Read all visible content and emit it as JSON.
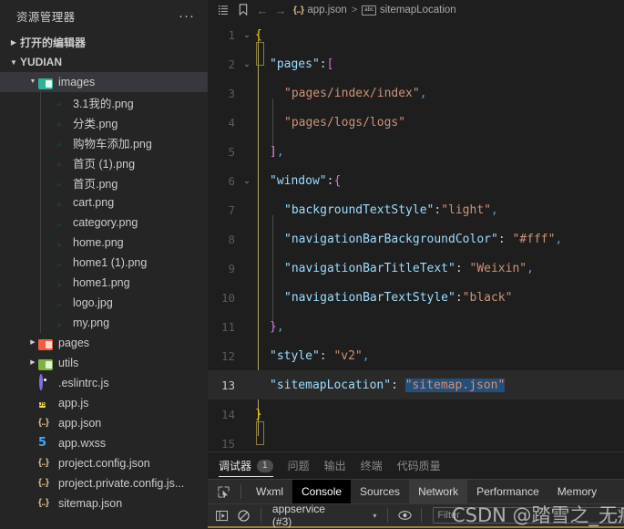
{
  "sidebar": {
    "title": "资源管理器",
    "more_label": "···",
    "sections": [
      {
        "label": "打开的编辑器",
        "expanded": false,
        "twisty": "▶"
      },
      {
        "label": "YUDIAN",
        "expanded": true,
        "twisty": "▼"
      }
    ],
    "tree": [
      {
        "label": "images",
        "icon": "folder-teal-icon",
        "depth": 1,
        "twisty": "▼",
        "selected": true
      },
      {
        "label": "3.1我的.png",
        "icon": "image-file-icon",
        "depth": 2,
        "twisty": "",
        "selected": false
      },
      {
        "label": "分类.png",
        "icon": "image-file-icon",
        "depth": 2,
        "twisty": "",
        "selected": false
      },
      {
        "label": "购物车添加.png",
        "icon": "image-file-icon",
        "depth": 2,
        "twisty": "",
        "selected": false
      },
      {
        "label": "首页 (1).png",
        "icon": "image-file-icon",
        "depth": 2,
        "twisty": "",
        "selected": false
      },
      {
        "label": "首页.png",
        "icon": "image-file-icon",
        "depth": 2,
        "twisty": "",
        "selected": false
      },
      {
        "label": "cart.png",
        "icon": "image-file-icon",
        "depth": 2,
        "twisty": "",
        "selected": false
      },
      {
        "label": "category.png",
        "icon": "image-file-icon",
        "depth": 2,
        "twisty": "",
        "selected": false
      },
      {
        "label": "home.png",
        "icon": "image-file-icon",
        "depth": 2,
        "twisty": "",
        "selected": false
      },
      {
        "label": "home1 (1).png",
        "icon": "image-file-icon",
        "depth": 2,
        "twisty": "",
        "selected": false
      },
      {
        "label": "home1.png",
        "icon": "image-file-icon",
        "depth": 2,
        "twisty": "",
        "selected": false
      },
      {
        "label": "logo.jpg",
        "icon": "image-file-icon",
        "depth": 2,
        "twisty": "",
        "selected": false
      },
      {
        "label": "my.png",
        "icon": "image-file-icon",
        "depth": 2,
        "twisty": "",
        "selected": false
      },
      {
        "label": "pages",
        "icon": "folder-orange-icon",
        "depth": 1,
        "twisty": "▶",
        "selected": false
      },
      {
        "label": "utils",
        "icon": "folder-green-icon",
        "depth": 1,
        "twisty": "▶",
        "selected": false
      },
      {
        "label": ".eslintrc.js",
        "icon": "eslint-icon",
        "depth": 1,
        "twisty": "",
        "selected": false
      },
      {
        "label": "app.js",
        "icon": "js-file-icon",
        "depth": 1,
        "twisty": "",
        "selected": false
      },
      {
        "label": "app.json",
        "icon": "json-file-icon",
        "depth": 1,
        "twisty": "",
        "selected": false
      },
      {
        "label": "app.wxss",
        "icon": "css-file-icon",
        "depth": 1,
        "twisty": "",
        "selected": false
      },
      {
        "label": "project.config.json",
        "icon": "json-file-icon",
        "depth": 1,
        "twisty": "",
        "selected": false
      },
      {
        "label": "project.private.config.js...",
        "icon": "json-file-icon",
        "depth": 1,
        "twisty": "",
        "selected": false
      },
      {
        "label": "sitemap.json",
        "icon": "json-file-icon",
        "depth": 1,
        "twisty": "",
        "selected": false
      }
    ]
  },
  "breadcrumb": {
    "outline_icon": "outline-list-icon",
    "bookmark_icon": "bookmark-icon",
    "back_arrow": "←",
    "forward_arrow": "→",
    "file_icon": "{..}",
    "file_label": "app.json",
    "separator": ">",
    "symbol_icon": "abc",
    "symbol_label": "sitemapLocation"
  },
  "editor": {
    "file": "app.json",
    "current_line": 13,
    "selection_text": "\"sitemap.json\"",
    "lines": [
      {
        "n": 1,
        "fold": "⌄",
        "indent": 0,
        "tokens": [
          {
            "t": "{",
            "c": "t-punct"
          }
        ]
      },
      {
        "n": 2,
        "fold": "⌄",
        "indent": 1,
        "tokens": [
          {
            "t": "\"pages\"",
            "c": "t-key"
          },
          {
            "t": ":",
            "c": "t-colon"
          },
          {
            "t": "[",
            "c": "t-brack"
          }
        ]
      },
      {
        "n": 3,
        "fold": "",
        "indent": 2,
        "tokens": [
          {
            "t": "\"pages/index/index\"",
            "c": "t-str"
          },
          {
            "t": ",",
            "c": "t-comma"
          }
        ]
      },
      {
        "n": 4,
        "fold": "",
        "indent": 2,
        "tokens": [
          {
            "t": "\"pages/logs/logs\"",
            "c": "t-str"
          }
        ]
      },
      {
        "n": 5,
        "fold": "",
        "indent": 1,
        "tokens": [
          {
            "t": "]",
            "c": "t-brack"
          },
          {
            "t": ",",
            "c": "t-comma"
          }
        ]
      },
      {
        "n": 6,
        "fold": "⌄",
        "indent": 1,
        "tokens": [
          {
            "t": "\"window\"",
            "c": "t-key"
          },
          {
            "t": ":",
            "c": "t-colon"
          },
          {
            "t": "{",
            "c": "t-brack"
          }
        ]
      },
      {
        "n": 7,
        "fold": "",
        "indent": 2,
        "tokens": [
          {
            "t": "\"backgroundTextStyle\"",
            "c": "t-key"
          },
          {
            "t": ":",
            "c": "t-colon"
          },
          {
            "t": "\"light\"",
            "c": "t-str"
          },
          {
            "t": ",",
            "c": "t-comma"
          }
        ]
      },
      {
        "n": 8,
        "fold": "",
        "indent": 2,
        "tokens": [
          {
            "t": "\"navigationBarBackgroundColor\"",
            "c": "t-key"
          },
          {
            "t": ": ",
            "c": "t-colon"
          },
          {
            "t": "\"#fff\"",
            "c": "t-str"
          },
          {
            "t": ",",
            "c": "t-comma"
          }
        ]
      },
      {
        "n": 9,
        "fold": "",
        "indent": 2,
        "tokens": [
          {
            "t": "\"navigationBarTitleText\"",
            "c": "t-key"
          },
          {
            "t": ": ",
            "c": "t-colon"
          },
          {
            "t": "\"Weixin\"",
            "c": "t-str"
          },
          {
            "t": ",",
            "c": "t-comma"
          }
        ]
      },
      {
        "n": 10,
        "fold": "",
        "indent": 2,
        "tokens": [
          {
            "t": "\"navigationBarTextStyle\"",
            "c": "t-key"
          },
          {
            "t": ":",
            "c": "t-colon"
          },
          {
            "t": "\"black\"",
            "c": "t-str"
          }
        ]
      },
      {
        "n": 11,
        "fold": "",
        "indent": 1,
        "tokens": [
          {
            "t": "}",
            "c": "t-brack"
          },
          {
            "t": ",",
            "c": "t-comma"
          }
        ]
      },
      {
        "n": 12,
        "fold": "",
        "indent": 1,
        "tokens": [
          {
            "t": "\"style\"",
            "c": "t-key"
          },
          {
            "t": ": ",
            "c": "t-colon"
          },
          {
            "t": "\"v2\"",
            "c": "t-str"
          },
          {
            "t": ",",
            "c": "t-comma"
          }
        ]
      },
      {
        "n": 13,
        "fold": "",
        "indent": 1,
        "tokens": [
          {
            "t": "\"sitemapLocation\"",
            "c": "t-key"
          },
          {
            "t": ": ",
            "c": "t-colon"
          },
          {
            "t": "\"sitemap.json\"",
            "c": "t-str sel"
          }
        ]
      },
      {
        "n": 14,
        "fold": "",
        "indent": 0,
        "tokens": [
          {
            "t": "}",
            "c": "t-punct"
          }
        ]
      },
      {
        "n": 15,
        "fold": "",
        "indent": 0,
        "tokens": []
      }
    ]
  },
  "panel": {
    "tabs": [
      {
        "label": "调试器",
        "badge": "1",
        "active": true
      },
      {
        "label": "问题",
        "badge": "",
        "active": false
      },
      {
        "label": "输出",
        "badge": "",
        "active": false
      },
      {
        "label": "终端",
        "badge": "",
        "active": false
      },
      {
        "label": "代码质量",
        "badge": "",
        "active": false
      }
    ],
    "devtools": {
      "inspect_icon": "inspect-element-icon",
      "tabs": [
        {
          "label": "Wxml",
          "state": "normal"
        },
        {
          "label": "Console",
          "state": "selected"
        },
        {
          "label": "Sources",
          "state": "normal"
        },
        {
          "label": "Network",
          "state": "hover"
        },
        {
          "label": "Performance",
          "state": "normal"
        },
        {
          "label": "Memory",
          "state": "normal"
        }
      ]
    },
    "console": {
      "sidebar_toggle_icon": "console-sidebar-icon",
      "clear_icon": "clear-console-icon",
      "context": "appservice (#3)",
      "caret": "▾",
      "eye_icon": "live-expression-icon",
      "filter_placeholder": "Filter"
    }
  },
  "watermark": {
    "text": "CSDN @踏雪之_无痕"
  }
}
